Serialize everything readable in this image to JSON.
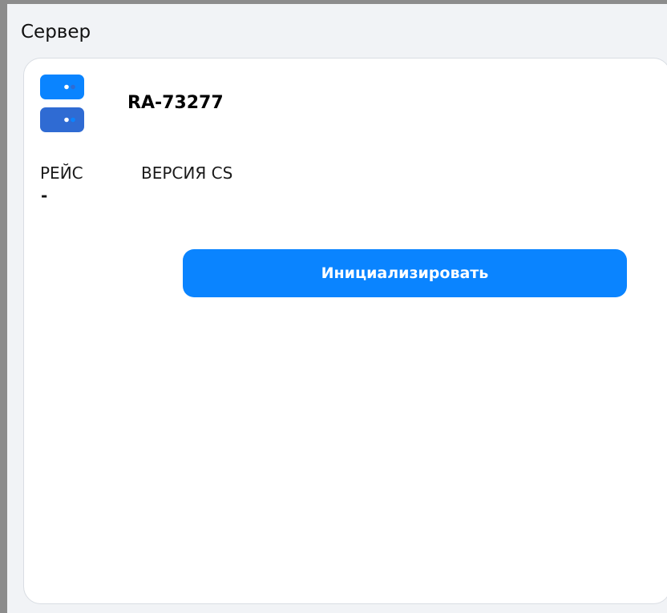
{
  "window": {
    "title": "Сервер"
  },
  "server": {
    "name": "RA-73277",
    "icon": "server-rack-icon"
  },
  "info": {
    "flight_label": "РЕЙС",
    "flight_value": "-",
    "cs_version_label": "ВЕРСИЯ CS"
  },
  "actions": {
    "initialize_label": "Инициализировать"
  },
  "colors": {
    "accent": "#0a84ff",
    "icon_top": "#0a84ff",
    "icon_bottom": "#2f6bd3",
    "background": "#f1f3f6",
    "card": "#ffffff"
  }
}
